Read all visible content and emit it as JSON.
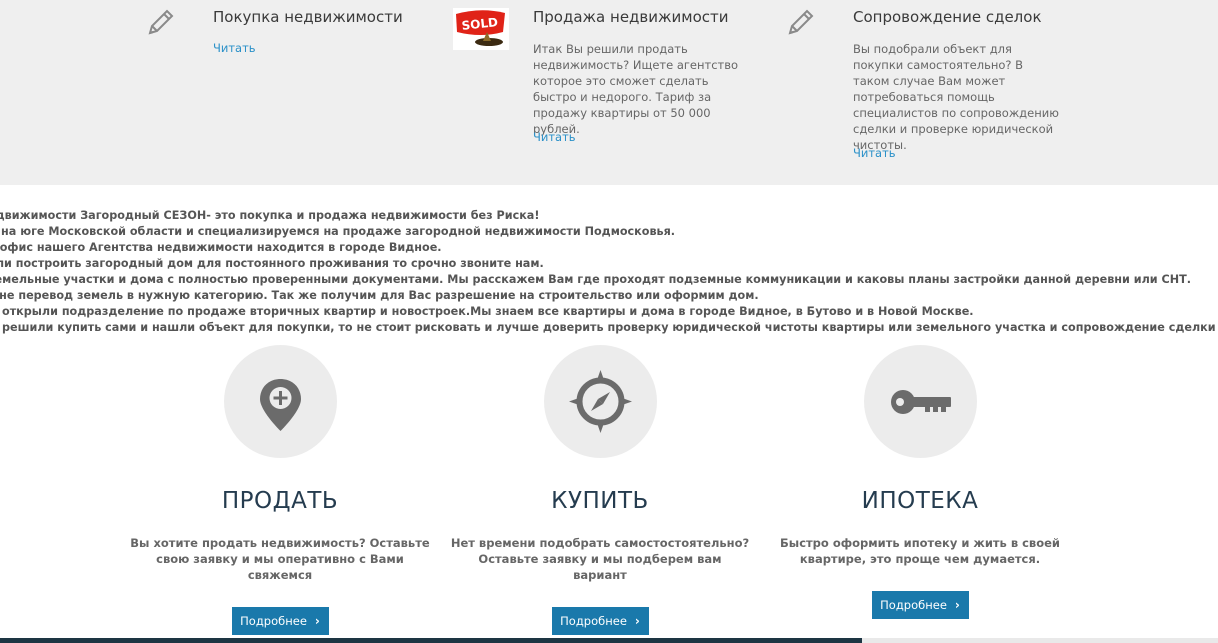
{
  "services": [
    {
      "icon": "pencil-icon",
      "title": "Покупка недвижимости",
      "description": "",
      "link": "Читать"
    },
    {
      "icon": "sold-sign-image",
      "image_text": "SOLD",
      "title": "Продажа недвижимости",
      "description": "Итак Вы решили продать недвижимость?  Ищете агентство которое это сможет сделать быстро и недорого. Тариф за продажу квартиры от 50 000 рублей.",
      "link": "Читать"
    },
    {
      "icon": "pencil-icon",
      "title": "Сопровождение сделок",
      "description": "Вы подобрали объект для покупки самостоятельно? В таком случае Вам может потребоваться помощь специалистов по сопровождению сделки и проверке юридической чистоты.",
      "link": "Читать"
    }
  ],
  "about": {
    "lines": [
      "едвижимости Загородный СЕЗОН- это покупка и продажа недвижимости без Риска!",
      "м на юге Московской области и специализируемся на продаже загородной недвижимости Подмосковья.",
      "й офис нашего Агентства недвижимости находится в городе Видное.",
      "или построить загородный дом для постоянного проживания то срочно звоните нам.",
      " земельные участки и дома с полностью проверенными документами. Мы расскажем Вам где проходят подземные коммуникации и каковы планы застройки данной деревни или СНТ.",
      "жне перевод земель в нужную категорию. Так же получим для Вас разрешение на строительство или оформим дом.",
      "ы открыли подразделение по продаже вторичных квартир и новостроек.Мы знаем все квартиры и дома в городе Видное, в Бутово и в Новой Москве.",
      "ы решили купить сами и нашли объект для покупки, то не стоит рисковать и лучше доверить проверку юридической чистоты квартиры или земельного участка и сопровождение сделки профессионалам"
    ]
  },
  "features": [
    {
      "icon": "map-pin-plus-icon",
      "title": "ПРОДАТЬ",
      "description": "Вы хотите продать недвижимость? Оставьте свою заявку и мы оперативно с Вами свяжемся",
      "button": "Подробнее"
    },
    {
      "icon": "compass-icon",
      "title": "КУПИТЬ",
      "description": "Нет времени подобрать самостостоятельно? Оставьте заявку и мы подберем вам вариант",
      "button": "Подробнее"
    },
    {
      "icon": "key-icon",
      "title": "ИПОТЕКА",
      "description": "Быстро оформить ипотеку и жить в своей квартире, это проще чем думается.",
      "button": "Подробнее"
    }
  ],
  "colors": {
    "band": "#efefef",
    "link": "#2a90c8",
    "button": "#1a79ab",
    "heading": "#253c4f",
    "icon": "#6b6b6b"
  }
}
